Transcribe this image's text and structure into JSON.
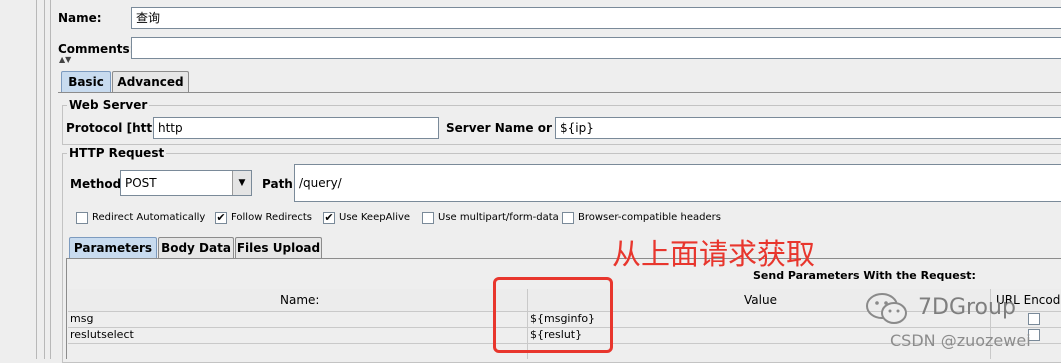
{
  "form": {
    "name_label": "Name:",
    "name_value": "查询",
    "comments_label": "Comments:",
    "comments_value": ""
  },
  "tabs": {
    "basic": "Basic",
    "advanced": "Advanced"
  },
  "web_server": {
    "title": "Web Server",
    "protocol_label": "Protocol [http]:",
    "protocol_value": "http",
    "server_label": "Server Name or IP:",
    "server_value": "${ip}"
  },
  "http_request": {
    "title": "HTTP Request",
    "method_label": "Method:",
    "method_value": "POST",
    "path_label": "Path:",
    "path_value": "/query/"
  },
  "options": [
    {
      "label": "Redirect Automatically",
      "checked": false
    },
    {
      "label": "Follow Redirects",
      "checked": true
    },
    {
      "label": "Use KeepAlive",
      "checked": true
    },
    {
      "label": "Use multipart/form-data",
      "checked": false
    },
    {
      "label": "Browser-compatible headers",
      "checked": false
    }
  ],
  "subtabs": {
    "parameters": "Parameters",
    "body_data": "Body Data",
    "files_upload": "Files Upload"
  },
  "params_table": {
    "caption": "Send Parameters With the Request:",
    "col_name": "Name:",
    "col_value": "Value",
    "col_encode": "URL Encode",
    "rows": [
      {
        "name": "msg",
        "value": "${msginfo}"
      },
      {
        "name": "reslutselect",
        "value": "${reslut}"
      }
    ]
  },
  "annotation": {
    "text": "从上面请求获取",
    "color": "#e8362d"
  },
  "watermark": {
    "brand": "7DGroup",
    "source": "CSDN @zuozewei"
  }
}
